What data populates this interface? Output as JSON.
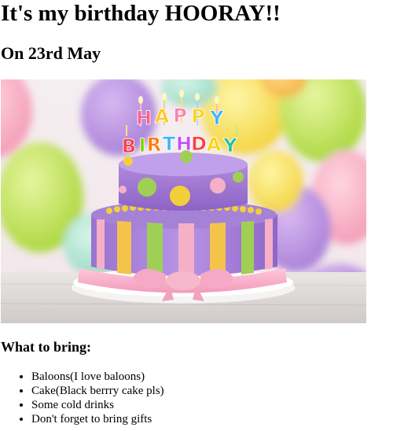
{
  "heading": "It's my birthday HOORAY!!",
  "date_line": "On 23rd May",
  "cake_image": {
    "alt": "Birthday cake",
    "topper_text": "HAPPY BIRTHDAY",
    "topper_colors": [
      "#ff4f7a",
      "#ffb400",
      "#3ab5ff",
      "#7ad400",
      "#ff7a00",
      "#c34dff",
      "#ff3d3d",
      "#ffd100",
      "#20c0a0"
    ]
  },
  "bring_heading": "What to bring:",
  "bring_items": [
    "Baloons(I love baloons)",
    "Cake(Black berrry cake pls)",
    "Some cold drinks",
    "Don't forget to bring gifts"
  ]
}
